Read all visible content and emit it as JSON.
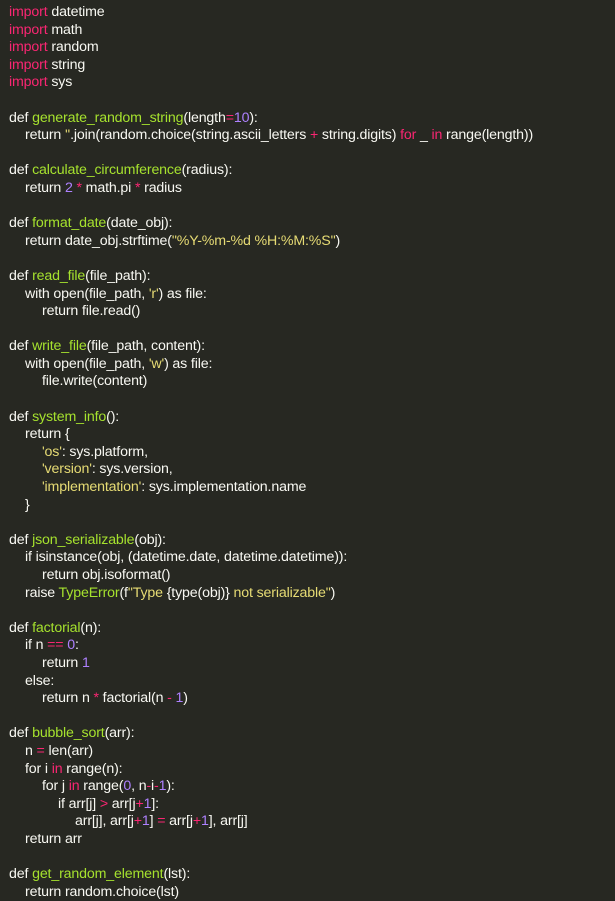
{
  "editor": {
    "colors": {
      "background": "#272822",
      "keyword": "#f92672",
      "function": "#a6e22e",
      "number": "#ae81ff",
      "string": "#e6db74",
      "text": "#f8f8f2"
    },
    "lines": [
      {
        "indent": 0,
        "tokens": [
          {
            "t": "kw",
            "v": "import"
          },
          {
            "t": "tx",
            "v": " datetime"
          }
        ]
      },
      {
        "indent": 0,
        "tokens": [
          {
            "t": "kw",
            "v": "import"
          },
          {
            "t": "tx",
            "v": " math"
          }
        ]
      },
      {
        "indent": 0,
        "tokens": [
          {
            "t": "kw",
            "v": "import"
          },
          {
            "t": "tx",
            "v": " random"
          }
        ]
      },
      {
        "indent": 0,
        "tokens": [
          {
            "t": "kw",
            "v": "import"
          },
          {
            "t": "tx",
            "v": " string"
          }
        ]
      },
      {
        "indent": 0,
        "tokens": [
          {
            "t": "kw",
            "v": "import"
          },
          {
            "t": "tx",
            "v": " sys"
          }
        ]
      },
      {
        "blank": true
      },
      {
        "indent": 0,
        "tokens": [
          {
            "t": "tx",
            "v": "def "
          },
          {
            "t": "fn",
            "v": "generate_random_string"
          },
          {
            "t": "tx",
            "v": "(length"
          },
          {
            "t": "op",
            "v": "="
          },
          {
            "t": "num",
            "v": "10"
          },
          {
            "t": "tx",
            "v": "):"
          }
        ]
      },
      {
        "indent": 1,
        "tokens": [
          {
            "t": "tx",
            "v": "return "
          },
          {
            "t": "str",
            "v": "''"
          },
          {
            "t": "tx",
            "v": ".join(random.choice(string.ascii_letters "
          },
          {
            "t": "op",
            "v": "+"
          },
          {
            "t": "tx",
            "v": " string.digits) "
          },
          {
            "t": "kw",
            "v": "for"
          },
          {
            "t": "tx",
            "v": " _ "
          },
          {
            "t": "kw",
            "v": "in"
          },
          {
            "t": "tx",
            "v": " range(length))"
          }
        ]
      },
      {
        "blank": true
      },
      {
        "indent": 0,
        "tokens": [
          {
            "t": "tx",
            "v": "def "
          },
          {
            "t": "fn",
            "v": "calculate_circumference"
          },
          {
            "t": "tx",
            "v": "(radius):"
          }
        ]
      },
      {
        "indent": 1,
        "tokens": [
          {
            "t": "tx",
            "v": "return "
          },
          {
            "t": "num",
            "v": "2"
          },
          {
            "t": "tx",
            "v": " "
          },
          {
            "t": "op",
            "v": "*"
          },
          {
            "t": "tx",
            "v": " math.pi "
          },
          {
            "t": "op",
            "v": "*"
          },
          {
            "t": "tx",
            "v": " radius"
          }
        ]
      },
      {
        "blank": true
      },
      {
        "indent": 0,
        "tokens": [
          {
            "t": "tx",
            "v": "def "
          },
          {
            "t": "fn",
            "v": "format_date"
          },
          {
            "t": "tx",
            "v": "(date_obj):"
          }
        ]
      },
      {
        "indent": 1,
        "tokens": [
          {
            "t": "tx",
            "v": "return date_obj.strftime("
          },
          {
            "t": "str",
            "v": "\"%Y-%m-%d %H:%M:%S\""
          },
          {
            "t": "tx",
            "v": ")"
          }
        ]
      },
      {
        "blank": true
      },
      {
        "indent": 0,
        "tokens": [
          {
            "t": "tx",
            "v": "def "
          },
          {
            "t": "fn",
            "v": "read_file"
          },
          {
            "t": "tx",
            "v": "(file_path):"
          }
        ]
      },
      {
        "indent": 1,
        "tokens": [
          {
            "t": "tx",
            "v": "with open(file_path, "
          },
          {
            "t": "str",
            "v": "'r'"
          },
          {
            "t": "tx",
            "v": ") as file:"
          }
        ]
      },
      {
        "indent": 2,
        "tokens": [
          {
            "t": "tx",
            "v": "return file.read()"
          }
        ]
      },
      {
        "blank": true
      },
      {
        "indent": 0,
        "tokens": [
          {
            "t": "tx",
            "v": "def "
          },
          {
            "t": "fn",
            "v": "write_file"
          },
          {
            "t": "tx",
            "v": "(file_path, content):"
          }
        ]
      },
      {
        "indent": 1,
        "tokens": [
          {
            "t": "tx",
            "v": "with open(file_path, "
          },
          {
            "t": "str",
            "v": "'w'"
          },
          {
            "t": "tx",
            "v": ") as file:"
          }
        ]
      },
      {
        "indent": 2,
        "tokens": [
          {
            "t": "tx",
            "v": "file.write(content)"
          }
        ]
      },
      {
        "blank": true
      },
      {
        "indent": 0,
        "tokens": [
          {
            "t": "tx",
            "v": "def "
          },
          {
            "t": "fn",
            "v": "system_info"
          },
          {
            "t": "tx",
            "v": "():"
          }
        ]
      },
      {
        "indent": 1,
        "tokens": [
          {
            "t": "tx",
            "v": "return {"
          }
        ]
      },
      {
        "indent": 2,
        "tokens": [
          {
            "t": "str",
            "v": "'os'"
          },
          {
            "t": "tx",
            "v": ": sys.platform,"
          }
        ]
      },
      {
        "indent": 2,
        "tokens": [
          {
            "t": "str",
            "v": "'version'"
          },
          {
            "t": "tx",
            "v": ": sys.version,"
          }
        ]
      },
      {
        "indent": 2,
        "tokens": [
          {
            "t": "str",
            "v": "'implementation'"
          },
          {
            "t": "tx",
            "v": ": sys.implementation.name"
          }
        ]
      },
      {
        "indent": 1,
        "tokens": [
          {
            "t": "tx",
            "v": "}"
          }
        ]
      },
      {
        "blank": true
      },
      {
        "indent": 0,
        "tokens": [
          {
            "t": "tx",
            "v": "def "
          },
          {
            "t": "fn",
            "v": "json_serializable"
          },
          {
            "t": "tx",
            "v": "(obj):"
          }
        ]
      },
      {
        "indent": 1,
        "tokens": [
          {
            "t": "tx",
            "v": "if isinstance(obj, (datetime.date, datetime.datetime)):"
          }
        ]
      },
      {
        "indent": 2,
        "tokens": [
          {
            "t": "tx",
            "v": "return obj.isoformat()"
          }
        ]
      },
      {
        "indent": 1,
        "tokens": [
          {
            "t": "tx",
            "v": "raise "
          },
          {
            "t": "fn",
            "v": "TypeError"
          },
          {
            "t": "tx",
            "v": "(f"
          },
          {
            "t": "str",
            "v": "\"Type "
          },
          {
            "t": "tx",
            "v": "{type(obj)}"
          },
          {
            "t": "str",
            "v": " not serializable\""
          },
          {
            "t": "tx",
            "v": ")"
          }
        ]
      },
      {
        "blank": true
      },
      {
        "indent": 0,
        "tokens": [
          {
            "t": "tx",
            "v": "def "
          },
          {
            "t": "fn",
            "v": "factorial"
          },
          {
            "t": "tx",
            "v": "(n):"
          }
        ]
      },
      {
        "indent": 1,
        "tokens": [
          {
            "t": "tx",
            "v": "if n "
          },
          {
            "t": "op",
            "v": "=="
          },
          {
            "t": "tx",
            "v": " "
          },
          {
            "t": "num",
            "v": "0"
          },
          {
            "t": "tx",
            "v": ":"
          }
        ]
      },
      {
        "indent": 2,
        "tokens": [
          {
            "t": "tx",
            "v": "return "
          },
          {
            "t": "num",
            "v": "1"
          }
        ]
      },
      {
        "indent": 1,
        "tokens": [
          {
            "t": "tx",
            "v": "else:"
          }
        ]
      },
      {
        "indent": 2,
        "tokens": [
          {
            "t": "tx",
            "v": "return n "
          },
          {
            "t": "op",
            "v": "*"
          },
          {
            "t": "tx",
            "v": " factorial(n "
          },
          {
            "t": "op",
            "v": "-"
          },
          {
            "t": "tx",
            "v": " "
          },
          {
            "t": "num",
            "v": "1"
          },
          {
            "t": "tx",
            "v": ")"
          }
        ]
      },
      {
        "blank": true
      },
      {
        "indent": 0,
        "tokens": [
          {
            "t": "tx",
            "v": "def "
          },
          {
            "t": "fn",
            "v": "bubble_sort"
          },
          {
            "t": "tx",
            "v": "(arr):"
          }
        ]
      },
      {
        "indent": 1,
        "tokens": [
          {
            "t": "tx",
            "v": "n "
          },
          {
            "t": "op",
            "v": "="
          },
          {
            "t": "tx",
            "v": " len(arr)"
          }
        ]
      },
      {
        "indent": 1,
        "tokens": [
          {
            "t": "tx",
            "v": "for i "
          },
          {
            "t": "kw",
            "v": "in"
          },
          {
            "t": "tx",
            "v": " range(n):"
          }
        ]
      },
      {
        "indent": 2,
        "tokens": [
          {
            "t": "tx",
            "v": "for j "
          },
          {
            "t": "kw",
            "v": "in"
          },
          {
            "t": "tx",
            "v": " range("
          },
          {
            "t": "num",
            "v": "0"
          },
          {
            "t": "tx",
            "v": ", n"
          },
          {
            "t": "op",
            "v": "-"
          },
          {
            "t": "tx",
            "v": "i"
          },
          {
            "t": "op",
            "v": "-"
          },
          {
            "t": "num",
            "v": "1"
          },
          {
            "t": "tx",
            "v": "):"
          }
        ]
      },
      {
        "indent": 3,
        "tokens": [
          {
            "t": "tx",
            "v": "if arr[j] "
          },
          {
            "t": "op",
            "v": ">"
          },
          {
            "t": "tx",
            "v": " arr[j"
          },
          {
            "t": "op",
            "v": "+"
          },
          {
            "t": "num",
            "v": "1"
          },
          {
            "t": "tx",
            "v": "]:"
          }
        ]
      },
      {
        "indent": 4,
        "tokens": [
          {
            "t": "tx",
            "v": "arr[j], arr[j"
          },
          {
            "t": "op",
            "v": "+"
          },
          {
            "t": "num",
            "v": "1"
          },
          {
            "t": "tx",
            "v": "] "
          },
          {
            "t": "op",
            "v": "="
          },
          {
            "t": "tx",
            "v": " arr[j"
          },
          {
            "t": "op",
            "v": "+"
          },
          {
            "t": "num",
            "v": "1"
          },
          {
            "t": "tx",
            "v": "], arr[j]"
          }
        ]
      },
      {
        "indent": 1,
        "tokens": [
          {
            "t": "tx",
            "v": "return arr"
          }
        ]
      },
      {
        "blank": true
      },
      {
        "indent": 0,
        "tokens": [
          {
            "t": "tx",
            "v": "def "
          },
          {
            "t": "fn",
            "v": "get_random_element"
          },
          {
            "t": "tx",
            "v": "(lst):"
          }
        ]
      },
      {
        "indent": 1,
        "tokens": [
          {
            "t": "tx",
            "v": "return random.choice(lst)"
          }
        ]
      }
    ]
  }
}
